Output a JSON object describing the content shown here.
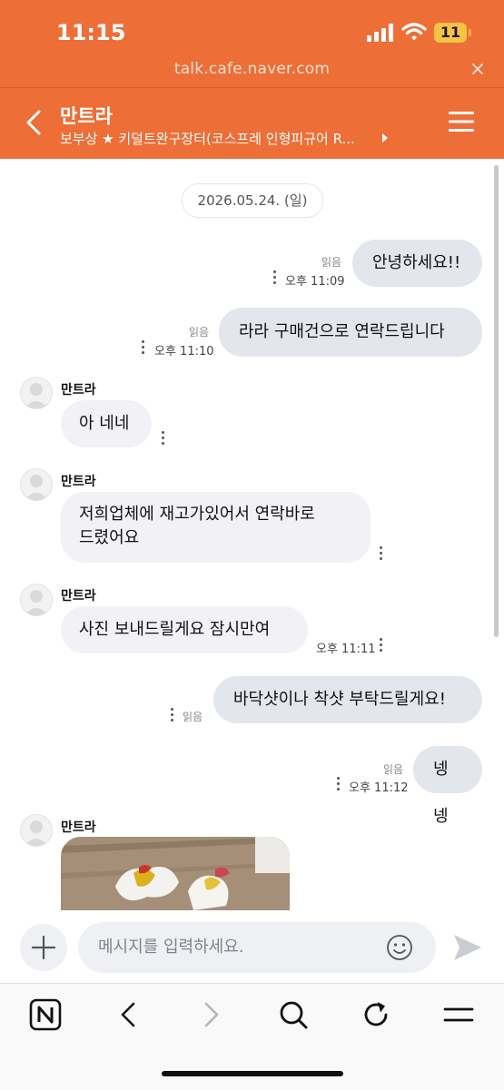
{
  "status_bar": {
    "time": "11:15",
    "battery": "11"
  },
  "browser": {
    "url": "talk.cafe.naver.com"
  },
  "header": {
    "title": "만트라",
    "subtitle": "보부상 ★ 키덜트완구장터(코스프레 인형피규어 R..."
  },
  "chat": {
    "date": "2026.05.24. (일)",
    "messages": [
      {
        "text": "안녕하세요!!",
        "read": "읽음",
        "time": "오후 11:09"
      },
      {
        "text": "라라 구매건으로 연락드립니다",
        "read": "읽음",
        "time": "오후 11:10"
      },
      {
        "sender": "만트라",
        "text": "아 네네"
      },
      {
        "sender": "만트라",
        "line1": "저희업체에 재고가있어서 연락바로",
        "line2": "드렸어요"
      },
      {
        "sender": "만트라",
        "text": "사진 보내드릴게요 잠시만여",
        "time": "오후 11:11"
      },
      {
        "text": "바닥샷이나 착샷 부탁드릴게요!",
        "read": "읽음"
      },
      {
        "text": "넹넹",
        "read": "읽음",
        "time": "오후 11:12"
      },
      {
        "sender": "만트라"
      }
    ]
  },
  "input": {
    "placeholder": "메시지를 입력하세요."
  },
  "icons": {
    "back": "chevron-left-icon",
    "menu": "hamburger-menu-icon",
    "plus": "plus-icon",
    "emoji": "smiley-icon",
    "send": "send-icon",
    "naver": "naver-n-icon",
    "nav_back": "chevron-left-icon",
    "nav_forward": "chevron-right-icon",
    "search": "search-icon",
    "reload": "reload-icon",
    "tabs": "tabs-menu-icon"
  },
  "colors": {
    "brand_orange": "#ee6e37",
    "bubble_out": "#e3e6ec",
    "bubble_in": "#f2f2f6"
  }
}
